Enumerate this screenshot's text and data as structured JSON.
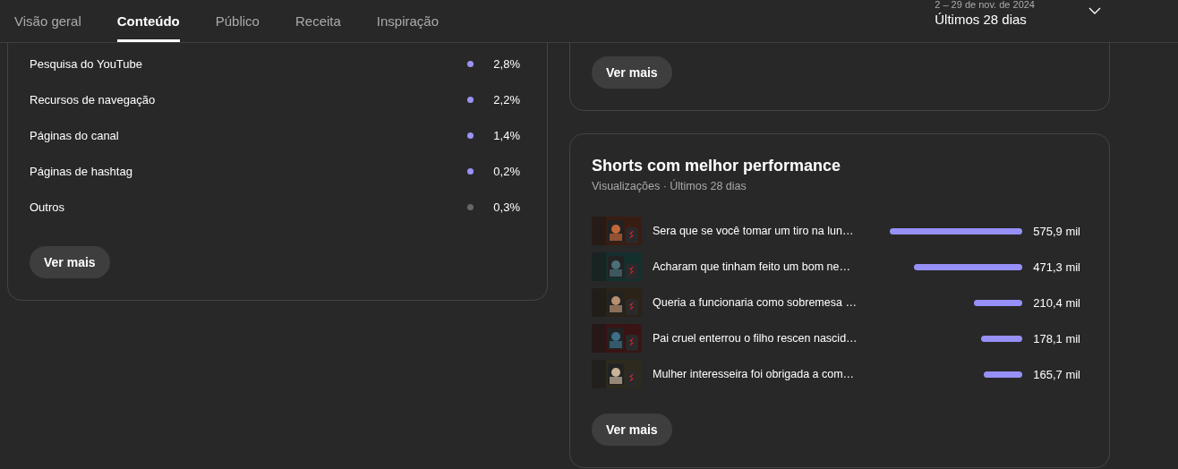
{
  "tabs": [
    {
      "label": "Visão geral",
      "selected": false
    },
    {
      "label": "Conteúdo",
      "selected": true
    },
    {
      "label": "Público",
      "selected": false
    },
    {
      "label": "Receita",
      "selected": false
    },
    {
      "label": "Inspiração",
      "selected": false
    }
  ],
  "date_picker": {
    "range": "2 – 29 de nov. de 2024",
    "period": "Últimos 28 dias"
  },
  "traffic_sources": {
    "items": [
      {
        "label": "Pesquisa do YouTube",
        "value": "2,8%",
        "color": "#9a93f5"
      },
      {
        "label": "Recursos de navegação",
        "value": "2,2%",
        "color": "#9a93f5"
      },
      {
        "label": "Páginas do canal",
        "value": "1,4%",
        "color": "#9a93f5"
      },
      {
        "label": "Páginas de hashtag",
        "value": "0,2%",
        "color": "#9a93f5"
      },
      {
        "label": "Outros",
        "value": "0,3%",
        "color": "#666666"
      }
    ],
    "button": "Ver mais"
  },
  "upper_card": {
    "button": "Ver mais"
  },
  "top_shorts": {
    "title": "Shorts com melhor performance",
    "subtitle": "Visualizações · Últimos 28 dias",
    "rows": [
      {
        "title": "Sera que se você tomar um tiro na lun…",
        "views": "575,9 mil"
      },
      {
        "title": "Acharam que tinham feito um bom ne…",
        "views": "471,3 mil"
      },
      {
        "title": "Queria a funcionaria como sobremesa …",
        "views": "210,4 mil"
      },
      {
        "title": "Pai cruel enterrou o filho rescen nascid…",
        "views": "178,1 mil"
      },
      {
        "title": "Mulher interesseira foi obrigada a com…",
        "views": "165,7 mil"
      }
    ],
    "button": "Ver mais"
  }
}
